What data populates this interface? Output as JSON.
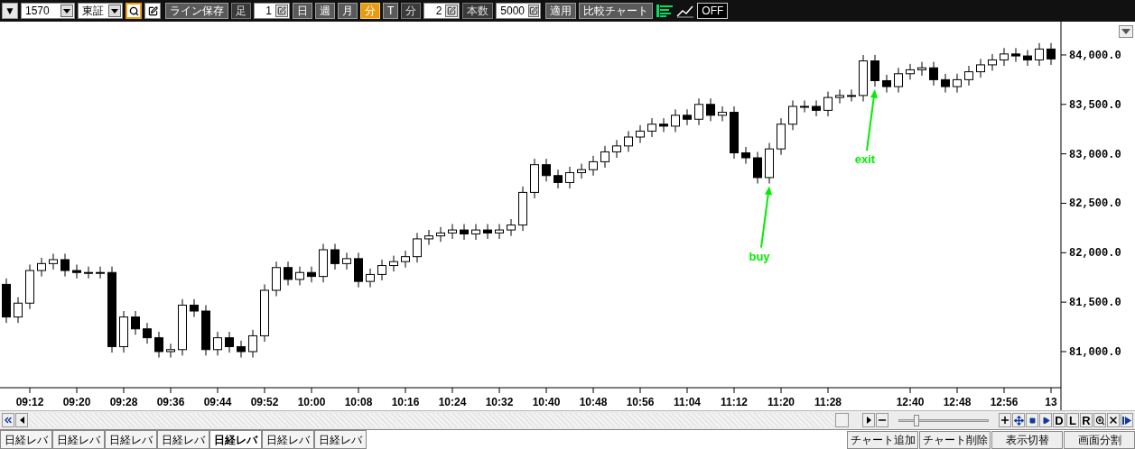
{
  "toolbar": {
    "menu_button": "▼",
    "code_field": {
      "value": "1570"
    },
    "market_field": {
      "value": "東証"
    },
    "line_save": "ライン保存",
    "period_label": "足",
    "period_value": "1",
    "periods": [
      {
        "label": "日",
        "selected": false
      },
      {
        "label": "週",
        "selected": false
      },
      {
        "label": "月",
        "selected": false
      },
      {
        "label": "分",
        "selected": true
      },
      {
        "label": "T",
        "selected": false
      }
    ],
    "interval_label": "分",
    "interval_value": "2",
    "count_label": "本数",
    "count_value": "5000",
    "apply": "適用",
    "compare": "比較チャート",
    "off": "OFF"
  },
  "chart": {
    "chart_data": {
      "type": "candlestick",
      "ylim": [
        80635,
        84337
      ],
      "categories": [
        null,
        null,
        "09:12",
        null,
        null,
        null,
        "09:20",
        null,
        null,
        null,
        "09:28",
        null,
        null,
        null,
        "09:36",
        null,
        null,
        null,
        "09:44",
        null,
        null,
        null,
        "09:52",
        null,
        null,
        null,
        "10:00",
        null,
        null,
        null,
        "10:08",
        null,
        null,
        null,
        "10:16",
        null,
        null,
        null,
        "10:24",
        null,
        null,
        null,
        "10:32",
        null,
        null,
        null,
        "10:40",
        null,
        null,
        null,
        "10:48",
        null,
        null,
        null,
        "10:56",
        null,
        null,
        null,
        "11:04",
        null,
        null,
        null,
        "11:12",
        null,
        null,
        null,
        "11:20",
        null,
        null,
        null,
        "11:28",
        null,
        null,
        null,
        null,
        null,
        null,
        "12:40",
        null,
        null,
        null,
        "12:48",
        null,
        null,
        null,
        "12:56",
        null,
        null,
        null,
        "13"
      ],
      "ohlc": [
        [
          81680,
          81740,
          81290,
          81350
        ],
        [
          81350,
          81550,
          81290,
          81490
        ],
        [
          81490,
          81880,
          81430,
          81820
        ],
        [
          81820,
          81950,
          81760,
          81890
        ],
        [
          81890,
          81990,
          81830,
          81930
        ],
        [
          81930,
          81990,
          81760,
          81820
        ],
        [
          81820,
          81880,
          81740,
          81800
        ],
        [
          81800,
          81860,
          81740,
          81800
        ],
        [
          81800,
          81860,
          81740,
          81800
        ],
        [
          81800,
          81860,
          80990,
          81050
        ],
        [
          81050,
          81410,
          80990,
          81350
        ],
        [
          81350,
          81410,
          81170,
          81230
        ],
        [
          81230,
          81290,
          81080,
          81140
        ],
        [
          81140,
          81200,
          80940,
          81000
        ],
        [
          81000,
          81080,
          80940,
          81020
        ],
        [
          81020,
          81530,
          80960,
          81470
        ],
        [
          81470,
          81530,
          81350,
          81410
        ],
        [
          81410,
          81470,
          80960,
          81020
        ],
        [
          81020,
          81200,
          80960,
          81140
        ],
        [
          81140,
          81200,
          80990,
          81050
        ],
        [
          81050,
          81110,
          80940,
          81000
        ],
        [
          81000,
          81220,
          80940,
          81160
        ],
        [
          81160,
          81680,
          81100,
          81620
        ],
        [
          81620,
          81910,
          81560,
          81850
        ],
        [
          81850,
          81910,
          81670,
          81730
        ],
        [
          81730,
          81860,
          81670,
          81800
        ],
        [
          81800,
          81860,
          81700,
          81760
        ],
        [
          81760,
          82090,
          81700,
          82030
        ],
        [
          82030,
          82090,
          81830,
          81890
        ],
        [
          81890,
          82000,
          81830,
          81940
        ],
        [
          81940,
          82000,
          81650,
          81710
        ],
        [
          81710,
          81840,
          81650,
          81780
        ],
        [
          81780,
          81930,
          81720,
          81870
        ],
        [
          81870,
          81970,
          81810,
          81910
        ],
        [
          81910,
          82020,
          81850,
          81960
        ],
        [
          81960,
          82200,
          81900,
          82140
        ],
        [
          82140,
          82230,
          82080,
          82170
        ],
        [
          82170,
          82260,
          82110,
          82200
        ],
        [
          82200,
          82290,
          82140,
          82230
        ],
        [
          82230,
          82290,
          82130,
          82190
        ],
        [
          82190,
          82290,
          82130,
          82230
        ],
        [
          82230,
          82290,
          82140,
          82200
        ],
        [
          82200,
          82290,
          82140,
          82230
        ],
        [
          82230,
          82340,
          82170,
          82280
        ],
        [
          82280,
          82670,
          82220,
          82610
        ],
        [
          82610,
          82950,
          82550,
          82890
        ],
        [
          82890,
          82950,
          82720,
          82780
        ],
        [
          82780,
          82840,
          82650,
          82710
        ],
        [
          82710,
          82870,
          82650,
          82810
        ],
        [
          82810,
          82900,
          82750,
          82840
        ],
        [
          82840,
          82980,
          82780,
          82920
        ],
        [
          82920,
          83080,
          82860,
          83020
        ],
        [
          83020,
          83140,
          82960,
          83080
        ],
        [
          83080,
          83230,
          83020,
          83170
        ],
        [
          83170,
          83290,
          83110,
          83230
        ],
        [
          83230,
          83360,
          83170,
          83300
        ],
        [
          83300,
          83360,
          83220,
          83280
        ],
        [
          83280,
          83450,
          83220,
          83390
        ],
        [
          83390,
          83450,
          83290,
          83350
        ],
        [
          83350,
          83560,
          83290,
          83500
        ],
        [
          83500,
          83560,
          83330,
          83390
        ],
        [
          83390,
          83480,
          83330,
          83420
        ],
        [
          83420,
          83480,
          82950,
          83010
        ],
        [
          83010,
          83070,
          82900,
          82960
        ],
        [
          82960,
          83020,
          82700,
          82760
        ],
        [
          82760,
          83110,
          82700,
          83050
        ],
        [
          83050,
          83360,
          82990,
          83300
        ],
        [
          83300,
          83540,
          83240,
          83480
        ],
        [
          83480,
          83540,
          83420,
          83480
        ],
        [
          83480,
          83540,
          83380,
          83440
        ],
        [
          83440,
          83630,
          83380,
          83570
        ],
        [
          83570,
          83650,
          83510,
          83590
        ],
        [
          83590,
          83650,
          83530,
          83590
        ],
        [
          83590,
          84000,
          83530,
          83940
        ],
        [
          83940,
          84000,
          83680,
          83740
        ],
        [
          83740,
          83800,
          83620,
          83680
        ],
        [
          83680,
          83870,
          83620,
          83810
        ],
        [
          83810,
          83910,
          83750,
          83850
        ],
        [
          83850,
          83930,
          83790,
          83870
        ],
        [
          83870,
          83930,
          83690,
          83750
        ],
        [
          83750,
          83810,
          83620,
          83680
        ],
        [
          83680,
          83810,
          83620,
          83750
        ],
        [
          83750,
          83890,
          83690,
          83830
        ],
        [
          83830,
          83960,
          83770,
          83900
        ],
        [
          83900,
          84010,
          83840,
          83950
        ],
        [
          83950,
          84070,
          83890,
          84010
        ],
        [
          84010,
          84070,
          83930,
          83990
        ],
        [
          83990,
          84050,
          83890,
          83950
        ],
        [
          83950,
          84120,
          83890,
          84060
        ],
        [
          84060,
          84120,
          83900,
          83960
        ]
      ],
      "yticks": [
        {
          "value": 81000,
          "label": "81,000.0"
        },
        {
          "value": 81500,
          "label": "81,500.0"
        },
        {
          "value": 82000,
          "label": "82,000.0"
        },
        {
          "value": 82500,
          "label": "82,500.0"
        },
        {
          "value": 83000,
          "label": "83,000.0"
        },
        {
          "value": 83500,
          "label": "83,500.0"
        },
        {
          "value": 84000,
          "label": "84,000.0"
        }
      ],
      "annotations": [
        "buy",
        "exit"
      ]
    }
  },
  "scrollbar": {
    "letter_buttons": [
      "D",
      "L",
      "R"
    ],
    "zoom_slider": {
      "level": 0.2
    }
  },
  "tabs": [
    {
      "label": "日経レバ",
      "selected": false
    },
    {
      "label": "日経レバ",
      "selected": false
    },
    {
      "label": "日経レバ",
      "selected": false
    },
    {
      "label": "日経レバ",
      "selected": false
    },
    {
      "label": "日経レバ",
      "selected": true
    },
    {
      "label": "日経レバ",
      "selected": false
    },
    {
      "label": "日経レバ",
      "selected": false
    }
  ],
  "bottom_buttons": [
    "チャート追加",
    "チャート削除",
    "表示切替",
    "画面分割"
  ]
}
